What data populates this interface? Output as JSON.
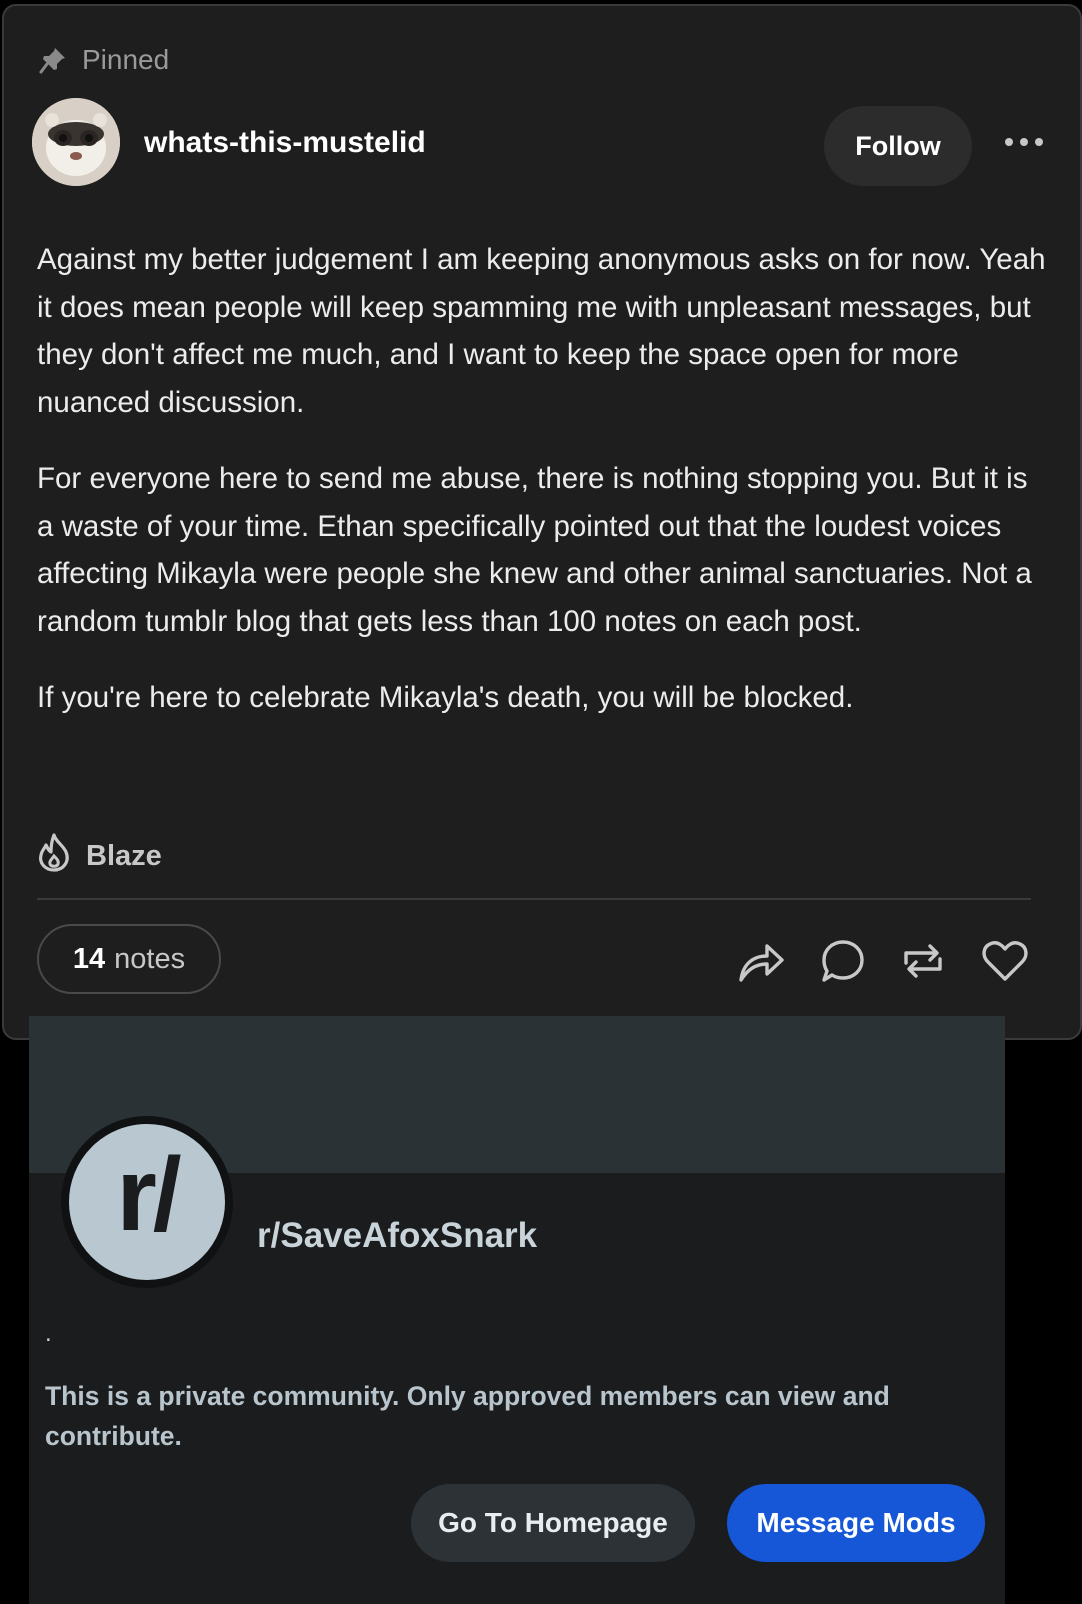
{
  "post": {
    "pinned_label": "Pinned",
    "username": "whats-this-mustelid",
    "follow_label": "Follow",
    "paragraphs": [
      "Against my better judgement I am keeping anonymous asks on for now. Yeah it does mean people will keep spamming me with unpleasant messages, but they don't affect me much, and I want to keep the space open for more nuanced discussion.",
      "For everyone here to send me abuse, there is nothing stopping you. But it is a waste of your time. Ethan specifically pointed out that the loudest voices affecting Mikayla were people she knew and other animal sanctuaries. Not a random tumblr blog that gets less than 100 notes on each post.",
      "If you're here to celebrate Mikayla's death, you will be blocked."
    ],
    "blaze_label": "Blaze",
    "notes_count": "14",
    "notes_label": "notes",
    "icons": [
      "pin-icon",
      "avatar",
      "more-icon",
      "flame-icon",
      "share-icon",
      "reply-icon",
      "reblog-icon",
      "heart-icon"
    ]
  },
  "reddit": {
    "icon_text": "r/",
    "subreddit_name": "r/SaveAfoxSnark",
    "description": ".",
    "private_notice": "This is a private community. Only approved members can view and contribute.",
    "homepage_label": "Go To Homepage",
    "message_mods_label": "Message Mods",
    "colors": {
      "primary_button": "#1557d6",
      "banner": "#2a3236",
      "icon_bg": "#b8c7d0"
    }
  }
}
